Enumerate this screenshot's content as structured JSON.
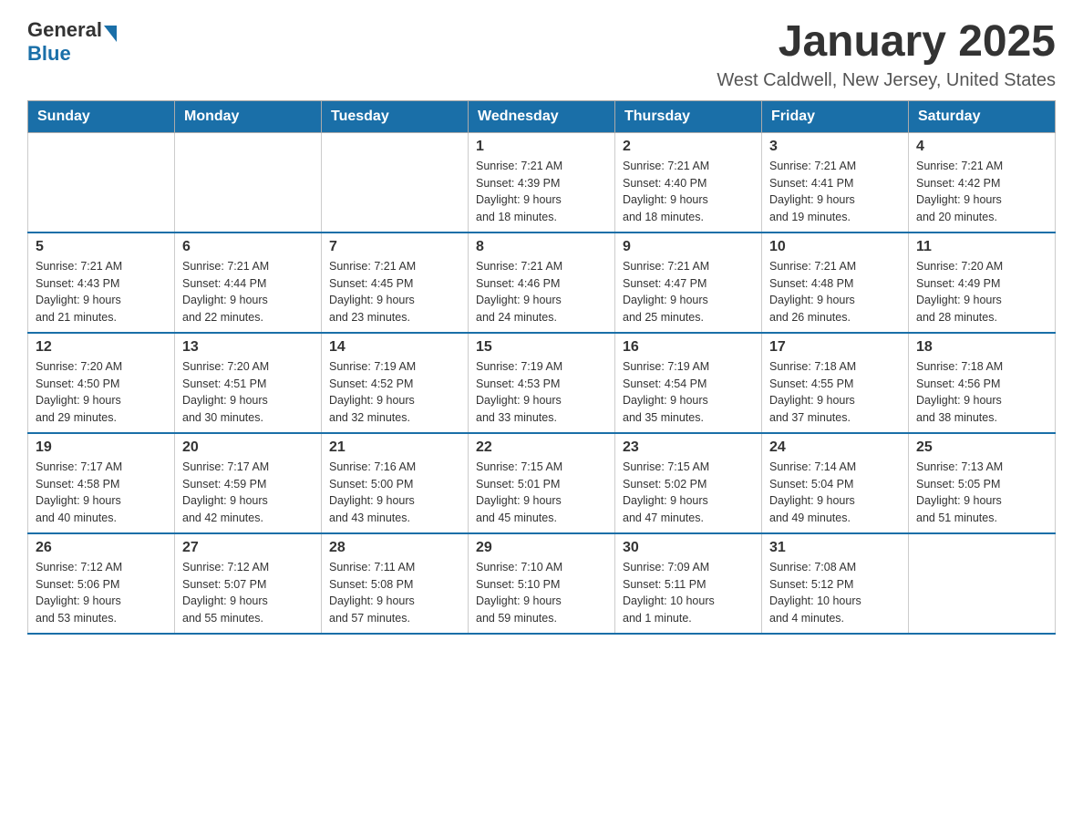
{
  "logo": {
    "general": "General",
    "blue": "Blue"
  },
  "title": "January 2025",
  "location": "West Caldwell, New Jersey, United States",
  "days_of_week": [
    "Sunday",
    "Monday",
    "Tuesday",
    "Wednesday",
    "Thursday",
    "Friday",
    "Saturday"
  ],
  "weeks": [
    [
      {
        "day": "",
        "info": ""
      },
      {
        "day": "",
        "info": ""
      },
      {
        "day": "",
        "info": ""
      },
      {
        "day": "1",
        "info": "Sunrise: 7:21 AM\nSunset: 4:39 PM\nDaylight: 9 hours\nand 18 minutes."
      },
      {
        "day": "2",
        "info": "Sunrise: 7:21 AM\nSunset: 4:40 PM\nDaylight: 9 hours\nand 18 minutes."
      },
      {
        "day": "3",
        "info": "Sunrise: 7:21 AM\nSunset: 4:41 PM\nDaylight: 9 hours\nand 19 minutes."
      },
      {
        "day": "4",
        "info": "Sunrise: 7:21 AM\nSunset: 4:42 PM\nDaylight: 9 hours\nand 20 minutes."
      }
    ],
    [
      {
        "day": "5",
        "info": "Sunrise: 7:21 AM\nSunset: 4:43 PM\nDaylight: 9 hours\nand 21 minutes."
      },
      {
        "day": "6",
        "info": "Sunrise: 7:21 AM\nSunset: 4:44 PM\nDaylight: 9 hours\nand 22 minutes."
      },
      {
        "day": "7",
        "info": "Sunrise: 7:21 AM\nSunset: 4:45 PM\nDaylight: 9 hours\nand 23 minutes."
      },
      {
        "day": "8",
        "info": "Sunrise: 7:21 AM\nSunset: 4:46 PM\nDaylight: 9 hours\nand 24 minutes."
      },
      {
        "day": "9",
        "info": "Sunrise: 7:21 AM\nSunset: 4:47 PM\nDaylight: 9 hours\nand 25 minutes."
      },
      {
        "day": "10",
        "info": "Sunrise: 7:21 AM\nSunset: 4:48 PM\nDaylight: 9 hours\nand 26 minutes."
      },
      {
        "day": "11",
        "info": "Sunrise: 7:20 AM\nSunset: 4:49 PM\nDaylight: 9 hours\nand 28 minutes."
      }
    ],
    [
      {
        "day": "12",
        "info": "Sunrise: 7:20 AM\nSunset: 4:50 PM\nDaylight: 9 hours\nand 29 minutes."
      },
      {
        "day": "13",
        "info": "Sunrise: 7:20 AM\nSunset: 4:51 PM\nDaylight: 9 hours\nand 30 minutes."
      },
      {
        "day": "14",
        "info": "Sunrise: 7:19 AM\nSunset: 4:52 PM\nDaylight: 9 hours\nand 32 minutes."
      },
      {
        "day": "15",
        "info": "Sunrise: 7:19 AM\nSunset: 4:53 PM\nDaylight: 9 hours\nand 33 minutes."
      },
      {
        "day": "16",
        "info": "Sunrise: 7:19 AM\nSunset: 4:54 PM\nDaylight: 9 hours\nand 35 minutes."
      },
      {
        "day": "17",
        "info": "Sunrise: 7:18 AM\nSunset: 4:55 PM\nDaylight: 9 hours\nand 37 minutes."
      },
      {
        "day": "18",
        "info": "Sunrise: 7:18 AM\nSunset: 4:56 PM\nDaylight: 9 hours\nand 38 minutes."
      }
    ],
    [
      {
        "day": "19",
        "info": "Sunrise: 7:17 AM\nSunset: 4:58 PM\nDaylight: 9 hours\nand 40 minutes."
      },
      {
        "day": "20",
        "info": "Sunrise: 7:17 AM\nSunset: 4:59 PM\nDaylight: 9 hours\nand 42 minutes."
      },
      {
        "day": "21",
        "info": "Sunrise: 7:16 AM\nSunset: 5:00 PM\nDaylight: 9 hours\nand 43 minutes."
      },
      {
        "day": "22",
        "info": "Sunrise: 7:15 AM\nSunset: 5:01 PM\nDaylight: 9 hours\nand 45 minutes."
      },
      {
        "day": "23",
        "info": "Sunrise: 7:15 AM\nSunset: 5:02 PM\nDaylight: 9 hours\nand 47 minutes."
      },
      {
        "day": "24",
        "info": "Sunrise: 7:14 AM\nSunset: 5:04 PM\nDaylight: 9 hours\nand 49 minutes."
      },
      {
        "day": "25",
        "info": "Sunrise: 7:13 AM\nSunset: 5:05 PM\nDaylight: 9 hours\nand 51 minutes."
      }
    ],
    [
      {
        "day": "26",
        "info": "Sunrise: 7:12 AM\nSunset: 5:06 PM\nDaylight: 9 hours\nand 53 minutes."
      },
      {
        "day": "27",
        "info": "Sunrise: 7:12 AM\nSunset: 5:07 PM\nDaylight: 9 hours\nand 55 minutes."
      },
      {
        "day": "28",
        "info": "Sunrise: 7:11 AM\nSunset: 5:08 PM\nDaylight: 9 hours\nand 57 minutes."
      },
      {
        "day": "29",
        "info": "Sunrise: 7:10 AM\nSunset: 5:10 PM\nDaylight: 9 hours\nand 59 minutes."
      },
      {
        "day": "30",
        "info": "Sunrise: 7:09 AM\nSunset: 5:11 PM\nDaylight: 10 hours\nand 1 minute."
      },
      {
        "day": "31",
        "info": "Sunrise: 7:08 AM\nSunset: 5:12 PM\nDaylight: 10 hours\nand 4 minutes."
      },
      {
        "day": "",
        "info": ""
      }
    ]
  ]
}
